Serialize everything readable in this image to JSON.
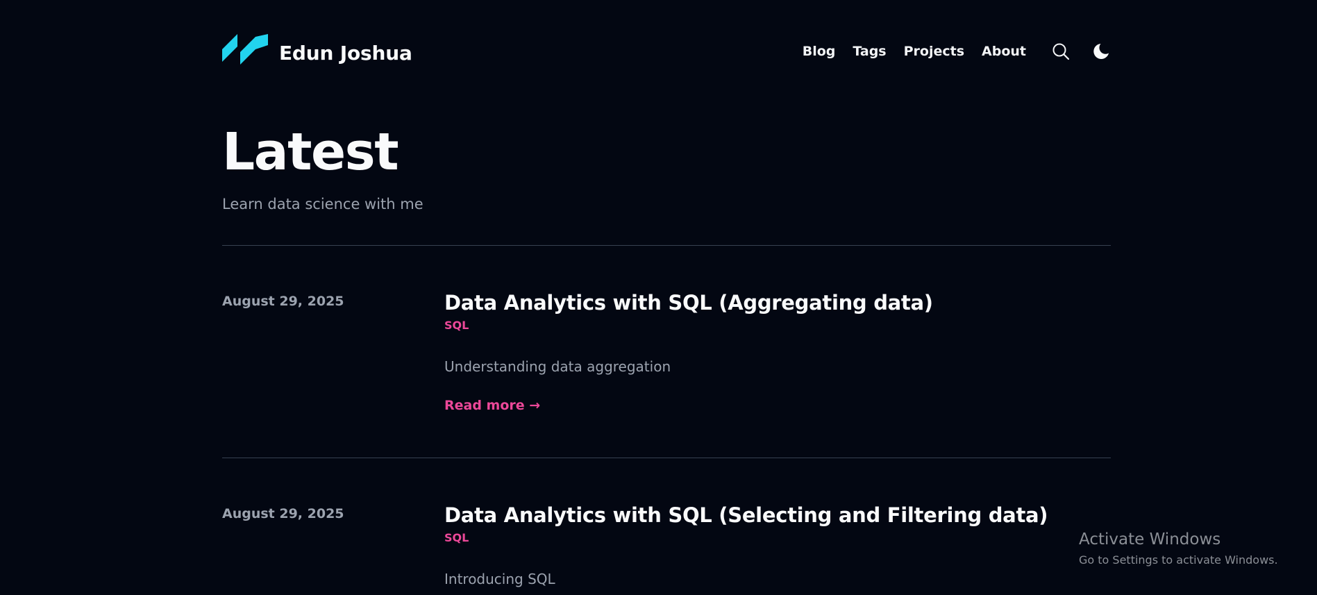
{
  "header": {
    "site_title": "Edun Joshua",
    "nav": [
      {
        "label": "Blog"
      },
      {
        "label": "Tags"
      },
      {
        "label": "Projects"
      },
      {
        "label": "About"
      }
    ],
    "logo_color": "#22d3ee"
  },
  "hero": {
    "title": "Latest",
    "subtitle": "Learn data science with me"
  },
  "posts": [
    {
      "date": "August 29, 2025",
      "title": "Data Analytics with SQL (Aggregating data)",
      "tag": "SQL",
      "summary": "Understanding data aggregation",
      "read_more": "Read more →"
    },
    {
      "date": "August 29, 2025",
      "title": "Data Analytics with SQL (Selecting and Filtering data)",
      "tag": "SQL",
      "summary": "Introducing SQL"
    }
  ],
  "watermark": {
    "title": "Activate Windows",
    "subtitle": "Go to Settings to activate Windows."
  },
  "colors": {
    "background": "#030712",
    "accent": "#ec4899",
    "muted_text": "#9ca3af",
    "divider": "#374151"
  },
  "icons": {
    "search": "search-icon",
    "theme": "moon-icon"
  }
}
